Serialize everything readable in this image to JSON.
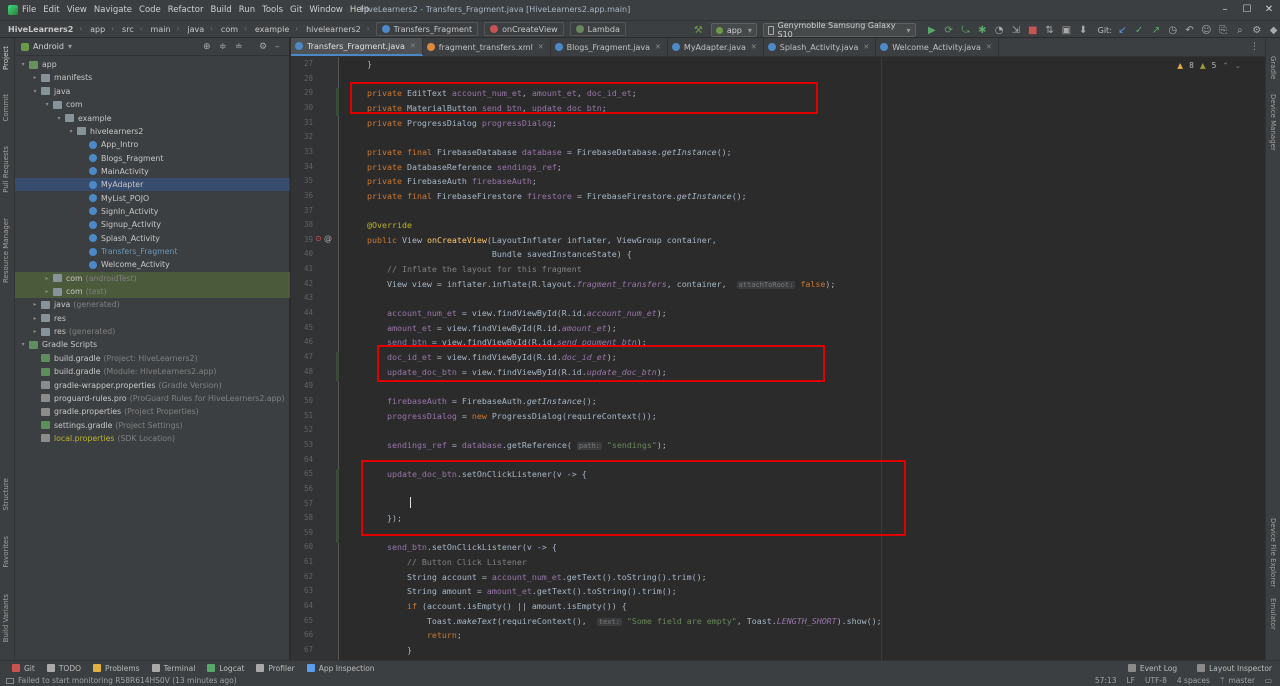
{
  "menu": {
    "items": [
      "File",
      "Edit",
      "View",
      "Navigate",
      "Code",
      "Refactor",
      "Build",
      "Run",
      "Tools",
      "Git",
      "Window",
      "Help"
    ],
    "title": "HiveLearners2 - Transfers_Fragment.java [HiveLearners2.app.main]"
  },
  "nav": {
    "breadcrumbs": [
      "HiveLearners2",
      "app",
      "src",
      "main",
      "java",
      "com",
      "example",
      "hivelearners2"
    ],
    "tags": [
      "Transfers_Fragment",
      "onCreateView",
      "Lambda"
    ],
    "run_config": "app",
    "device": "Genymobile Samsung Galaxy S10",
    "git_label": "Git:"
  },
  "project": {
    "view_label": "Android",
    "tree": [
      {
        "label": "app",
        "hint": "",
        "indent": 0,
        "arrow": "▾",
        "icon": "folder-g"
      },
      {
        "label": "manifests",
        "hint": "",
        "indent": 1,
        "arrow": "▸",
        "icon": "folder"
      },
      {
        "label": "java",
        "hint": "",
        "indent": 1,
        "arrow": "▾",
        "icon": "folder"
      },
      {
        "label": "com",
        "hint": "",
        "indent": 2,
        "arrow": "▾",
        "icon": "folder"
      },
      {
        "label": "example",
        "hint": "",
        "indent": 3,
        "arrow": "▾",
        "icon": "folder"
      },
      {
        "label": "hivelearners2",
        "hint": "",
        "indent": 4,
        "arrow": "▾",
        "icon": "folder"
      },
      {
        "label": "App_Intro",
        "hint": "",
        "indent": 5,
        "arrow": "",
        "icon": "cls"
      },
      {
        "label": "Blogs_Fragment",
        "hint": "",
        "indent": 5,
        "arrow": "",
        "icon": "cls"
      },
      {
        "label": "MainActivity",
        "hint": "",
        "indent": 5,
        "arrow": "",
        "icon": "cls"
      },
      {
        "label": "MyAdapter",
        "hint": "",
        "indent": 5,
        "arrow": "",
        "icon": "cls",
        "state": "sel"
      },
      {
        "label": "MyList_POJO",
        "hint": "",
        "indent": 5,
        "arrow": "",
        "icon": "cls"
      },
      {
        "label": "SignIn_Activity",
        "hint": "",
        "indent": 5,
        "arrow": "",
        "icon": "cls"
      },
      {
        "label": "Signup_Activity",
        "hint": "",
        "indent": 5,
        "arrow": "",
        "icon": "cls"
      },
      {
        "label": "Splash_Activity",
        "hint": "",
        "indent": 5,
        "arrow": "",
        "icon": "cls"
      },
      {
        "label": "Transfers_Fragment",
        "hint": "",
        "indent": 5,
        "arrow": "",
        "icon": "cls",
        "color": "#6897bb"
      },
      {
        "label": "Welcome_Activity",
        "hint": "",
        "indent": 5,
        "arrow": "",
        "icon": "cls"
      },
      {
        "label": "com",
        "hint": "(androidTest)",
        "indent": 2,
        "arrow": "▸",
        "icon": "folder",
        "state": "hl"
      },
      {
        "label": "com",
        "hint": "(test)",
        "indent": 2,
        "arrow": "▸",
        "icon": "folder",
        "state": "hl"
      },
      {
        "label": "java",
        "hint": "(generated)",
        "indent": 1,
        "arrow": "▸",
        "icon": "folder"
      },
      {
        "label": "res",
        "hint": "",
        "indent": 1,
        "arrow": "▸",
        "icon": "folder"
      },
      {
        "label": "res",
        "hint": "(generated)",
        "indent": 1,
        "arrow": "▸",
        "icon": "folder"
      },
      {
        "label": "Gradle Scripts",
        "hint": "",
        "indent": 0,
        "arrow": "▾",
        "icon": "grad"
      },
      {
        "label": "build.gradle",
        "hint": "(Project: HiveLearners2)",
        "indent": 1,
        "arrow": "",
        "icon": "grad"
      },
      {
        "label": "build.gradle",
        "hint": "(Module: HiveLearners2.app)",
        "indent": 1,
        "arrow": "",
        "icon": "grad"
      },
      {
        "label": "gradle-wrapper.properties",
        "hint": "(Gradle Version)",
        "indent": 1,
        "arrow": "",
        "icon": "prop"
      },
      {
        "label": "proguard-rules.pro",
        "hint": "(ProGuard Rules for HiveLearners2.app)",
        "indent": 1,
        "arrow": "",
        "icon": "prop"
      },
      {
        "label": "gradle.properties",
        "hint": "(Project Properties)",
        "indent": 1,
        "arrow": "",
        "icon": "prop"
      },
      {
        "label": "settings.gradle",
        "hint": "(Project Settings)",
        "indent": 1,
        "arrow": "",
        "icon": "grad"
      },
      {
        "label": "local.properties",
        "hint": "(SDK Location)",
        "indent": 1,
        "arrow": "",
        "icon": "prop",
        "color": "#bbb529"
      }
    ]
  },
  "tabs": [
    {
      "label": "Transfers_Fragment.java",
      "active": true,
      "color": "#4d89c9"
    },
    {
      "label": "fragment_transfers.xml",
      "active": false,
      "color": "#e08a3c"
    },
    {
      "label": "Blogs_Fragment.java",
      "active": false,
      "color": "#4d89c9"
    },
    {
      "label": "MyAdapter.java",
      "active": false,
      "color": "#4d89c9"
    },
    {
      "label": "Splash_Activity.java",
      "active": false,
      "color": "#4d89c9"
    },
    {
      "label": "Welcome_Activity.java",
      "active": false,
      "color": "#4d89c9"
    }
  ],
  "editor": {
    "warnings": "8",
    "weak_warnings": "5",
    "line_numbers": [
      "27",
      "28",
      "29",
      "30",
      "31",
      "32",
      "33",
      "34",
      "35",
      "36",
      "37",
      "38",
      "39",
      "40",
      "41",
      "42",
      "43",
      "44",
      "45",
      "46",
      "47",
      "48",
      "49",
      "50",
      "51",
      "52",
      "53",
      "64",
      "65",
      "56",
      "57",
      "58",
      "59",
      "60",
      "61",
      "62",
      "63",
      "64",
      "65",
      "66",
      "67"
    ],
    "lines": [
      "    }",
      "",
      "    private EditText account_num_et, amount_et, doc_id_et;",
      "    private MaterialButton send_btn, update_doc_btn;",
      "    private ProgressDialog progressDialog;",
      "",
      "    private final FirebaseDatabase database = FirebaseDatabase.getInstance();",
      "    private DatabaseReference sendings_ref;",
      "    private FirebaseAuth firebaseAuth;",
      "    private final FirebaseFirestore firestore = FirebaseFirestore.getInstance();",
      "",
      "    @Override",
      "    public View onCreateView(LayoutInflater inflater, ViewGroup container,",
      "                             Bundle savedInstanceState) {",
      "        // Inflate the layout for this fragment",
      "        View view = inflater.inflate(R.layout.fragment_transfers, container,  attachToRoot: false);",
      "",
      "        account_num_et = view.findViewById(R.id.account_num_et);",
      "        amount_et = view.findViewById(R.id.amount_et);",
      "        send_btn = view.findViewById(R.id.send_pqument_btn);",
      "        doc_id_et = view.findViewById(R.id.doc_id_et);",
      "        update_doc_btn = view.findViewById(R.id.update_doc_btn);",
      "",
      "        firebaseAuth = FirebaseAuth.getInstance();",
      "        progressDialog = new ProgressDialog(requireContext());",
      "",
      "        sendings_ref = database.getReference( path: \"sendings\");",
      "",
      "        update_doc_btn.setOnClickListener(v -> {",
      "",
      "",
      "        });",
      "",
      "        send_btn.setOnClickListener(v -> {",
      "            // Button Click Listener",
      "            String account = account_num_et.getText().toString().trim();",
      "            String amount = amount_et.getText().toString().trim();",
      "            if (account.isEmpty() || amount.isEmpty()) {",
      "                Toast.makeText(requireContext(),  text: \"Some field are empty\", Toast.LENGTH_SHORT).show();",
      "                return;",
      "            }"
    ]
  },
  "bottom_tools": [
    {
      "label": "Git",
      "icon": "git-icon"
    },
    {
      "label": "TODO",
      "icon": "list-icon"
    },
    {
      "label": "Problems",
      "icon": "problems-icon"
    },
    {
      "label": "Terminal",
      "icon": "terminal-icon"
    },
    {
      "label": "Logcat",
      "icon": "logcat-icon"
    },
    {
      "label": "Profiler",
      "icon": "profiler-icon"
    },
    {
      "label": "App Inspection",
      "icon": "inspection-icon"
    }
  ],
  "bottom_right_tools": [
    "Event Log",
    "Layout Inspector"
  ],
  "status": {
    "message": "Failed to start monitoring R58R614HS0V (13 minutes ago)",
    "position": "57:13",
    "line_sep": "LF",
    "encoding": "UTF-8",
    "indent": "4 spaces",
    "branch": "master"
  },
  "side_labels": {
    "left": [
      "Project",
      "Commit",
      "Pull Requests",
      "Resource Manager",
      "Structure",
      "Favorites",
      "Build Variants"
    ],
    "right": [
      "Gradle",
      "Device Manager",
      "Device File Explorer",
      "Emulator"
    ]
  }
}
